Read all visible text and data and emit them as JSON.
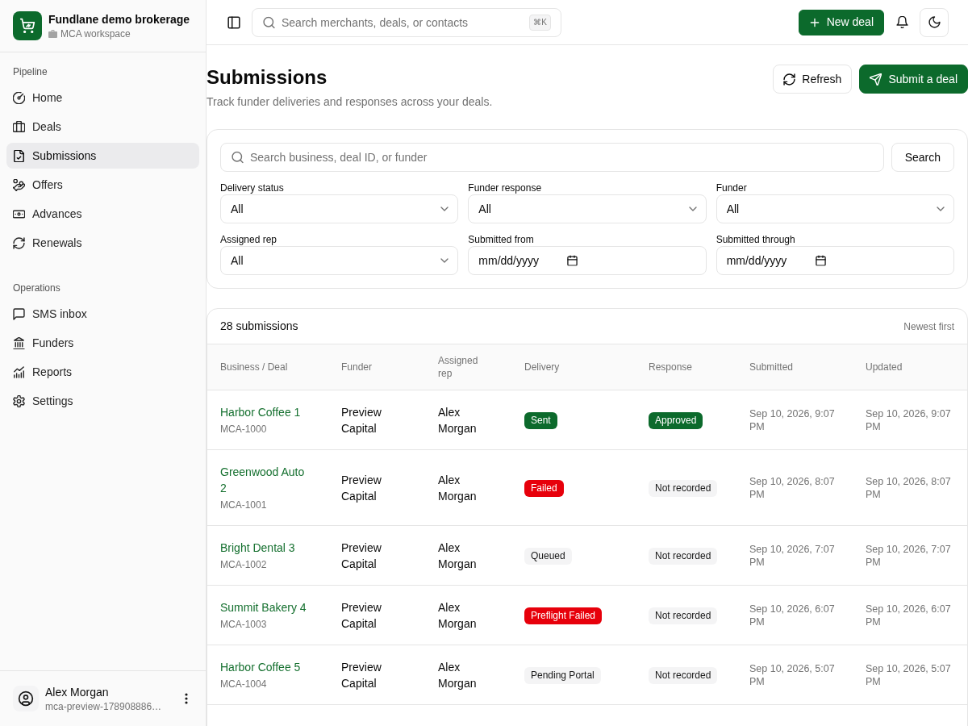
{
  "sidebar": {
    "brand": {
      "title": "Fundlane demo brokerage",
      "subtitle": "MCA workspace"
    },
    "sections": [
      {
        "label": "Pipeline",
        "items": [
          {
            "label": "Home",
            "selected": false
          },
          {
            "label": "Deals",
            "selected": false
          },
          {
            "label": "Submissions",
            "selected": true
          },
          {
            "label": "Offers",
            "selected": false
          },
          {
            "label": "Advances",
            "selected": false
          },
          {
            "label": "Renewals",
            "selected": false
          }
        ]
      },
      {
        "label": "Operations",
        "items": [
          {
            "label": "SMS inbox",
            "selected": false
          },
          {
            "label": "Funders",
            "selected": false
          },
          {
            "label": "Reports",
            "selected": false
          },
          {
            "label": "Settings",
            "selected": false
          }
        ]
      }
    ],
    "user": {
      "name": "Alex Morgan",
      "account": "mca-preview-178908886…"
    }
  },
  "topbar": {
    "search": {
      "placeholder": "Search merchants, deals, or contacts",
      "shortcut": "⌘K"
    },
    "new_deal_button": "New deal"
  },
  "page_header": {
    "title": "Submissions",
    "subtitle": "Track funder deliveries and responses across your deals.",
    "buttons": [
      {
        "label": "Refresh",
        "kind": "secondary"
      },
      {
        "label": "Submit a deal",
        "kind": "primary"
      }
    ]
  },
  "filters": {
    "search": {
      "placeholder": "Search business, deal ID, or funder"
    },
    "search_button": "Search",
    "fields": [
      {
        "label": "Delivery status",
        "kind": "select",
        "value": "All"
      },
      {
        "label": "Funder response",
        "kind": "select",
        "value": "All"
      },
      {
        "label": "Funder",
        "kind": "select",
        "value": "All"
      },
      {
        "label": "Assigned rep",
        "kind": "select",
        "value": "All"
      },
      {
        "label": "Submitted from",
        "kind": "date",
        "placeholder": "mm/dd/yyyy"
      },
      {
        "label": "Submitted through",
        "kind": "date",
        "placeholder": "mm/dd/yyyy"
      }
    ]
  },
  "table": {
    "count": "28 submissions",
    "sort": "Newest first",
    "columns": [
      "Business / Deal",
      "Funder",
      "Assigned rep",
      "Delivery",
      "Response",
      "Submitted",
      "Updated"
    ],
    "rows": [
      {
        "business": "Harbor Coffee 1",
        "deal_id": "MCA-1000",
        "funder": "Preview Capital",
        "rep": "Alex Morgan",
        "delivery": {
          "label": "Sent",
          "color": "#0c6a2c"
        },
        "response": {
          "label": "Approved",
          "color": "#0c6a2c"
        },
        "submitted": "Sep 10, 2026, 9:07 PM",
        "updated": "Sep 10, 2026, 9:07 PM"
      },
      {
        "business": "Greenwood Auto 2",
        "deal_id": "MCA-1001",
        "funder": "Preview Capital",
        "rep": "Alex Morgan",
        "delivery": {
          "label": "Failed",
          "color": "#e7000b"
        },
        "response": {
          "label": "Not recorded",
          "color": "#f4f4f5"
        },
        "submitted": "Sep 10, 2026, 8:07 PM",
        "updated": "Sep 10, 2026, 8:07 PM"
      },
      {
        "business": "Bright Dental 3",
        "deal_id": "MCA-1002",
        "funder": "Preview Capital",
        "rep": "Alex Morgan",
        "delivery": {
          "label": "Queued",
          "color": "#f4f4f5"
        },
        "response": {
          "label": "Not recorded",
          "color": "#f4f4f5"
        },
        "submitted": "Sep 10, 2026, 7:07 PM",
        "updated": "Sep 10, 2026, 7:07 PM"
      },
      {
        "business": "Summit Bakery 4",
        "deal_id": "MCA-1003",
        "funder": "Preview Capital",
        "rep": "Alex Morgan",
        "delivery": {
          "label": "Preflight Failed",
          "color": "#e7000b"
        },
        "response": {
          "label": "Not recorded",
          "color": "#f4f4f5"
        },
        "submitted": "Sep 10, 2026, 6:07 PM",
        "updated": "Sep 10, 2026, 6:07 PM"
      },
      {
        "business": "Harbor Coffee 5",
        "deal_id": "MCA-1004",
        "funder": "Preview Capital",
        "rep": "Alex Morgan",
        "delivery": {
          "label": "Pending Portal",
          "color": "#f4f4f5"
        },
        "response": {
          "label": "Not recorded",
          "color": "#f4f4f5"
        },
        "submitted": "Sep 10, 2026, 5:07 PM",
        "updated": "Sep 10, 2026, 5:07 PM"
      }
    ]
  }
}
